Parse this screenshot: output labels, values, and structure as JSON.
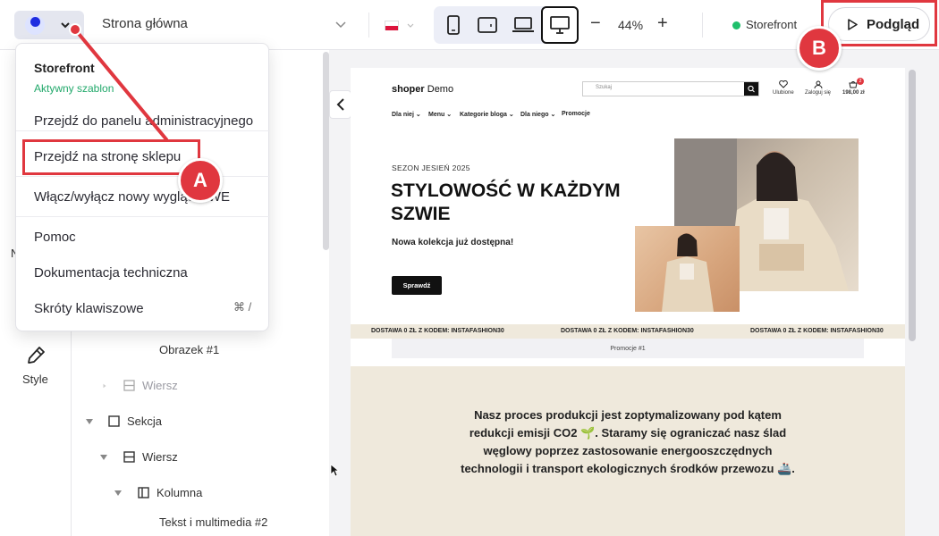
{
  "topbar": {
    "page_name": "Strona główna",
    "zoom": "44%",
    "zoom_minus": "−",
    "zoom_plus": "+",
    "status_label": "Storefront",
    "preview_label": "Podgląd",
    "devices": [
      "mobile",
      "tablet",
      "laptop",
      "desktop"
    ],
    "active_device": "desktop"
  },
  "menu": {
    "title": "Storefront",
    "subtitle": "Aktywny szablon",
    "items": [
      "Przejdź do panelu administracyjnego",
      "Przejdź na stronę sklepu",
      "Włącz/wyłącz nowy wygląd RWE",
      "Pomoc",
      "Dokumentacja techniczna",
      "Skróty klawiszowe"
    ],
    "shortcut": "⌘ /"
  },
  "rail": {
    "partial_label": "N",
    "style_label": "Style"
  },
  "tree": {
    "items": [
      {
        "label": "Obrazek #1",
        "icon": "none"
      },
      {
        "label": "Wiersz",
        "icon": "row-icon"
      },
      {
        "label": "Sekcja",
        "icon": "section-icon"
      },
      {
        "label": "Wiersz",
        "icon": "row-icon"
      },
      {
        "label": "Kolumna",
        "icon": "column-icon"
      },
      {
        "label": "Tekst i multimedia #2",
        "icon": "none"
      }
    ]
  },
  "annotations": {
    "a": "A",
    "b": "B"
  },
  "site": {
    "logo_bold": "shoper",
    "logo_rest": " Demo",
    "search_placeholder": "Szukaj",
    "header_icons": [
      "Ulubione",
      "Zaloguj się",
      "198,00 zł"
    ],
    "cart_count": "2",
    "nav": [
      "Dla niej",
      "Menu",
      "Kategorie bloga",
      "Dla niego",
      "Promocje"
    ],
    "hero_kicker": "SEZON JESIEŃ 2025",
    "hero_title": "STYLOWOŚĆ W KAŻDYM SZWIE",
    "hero_subtitle": "Nowa kolekcja już dostępna!",
    "hero_button": "Sprawdź",
    "promo_strip": "DOSTAWA 0 ZŁ Z KODEM: INSTAFASHION30",
    "promo_block": "Promocje #1",
    "eco_text": "Nasz proces produkcji jest zoptymalizowany pod kątem redukcji emisji CO2 🌱. Staramy się ograniczać nasz ślad węglowy poprzez zastosowanie energooszczędnych technologii i transport ekologicznych środków przewozu 🚢."
  },
  "colors": {
    "accent_red": "#e0373f",
    "status_green": "#1fbf6b",
    "subtitle_green": "#21a86a",
    "brand_blue": "#1f2de0",
    "beige": "#efe9dc"
  }
}
